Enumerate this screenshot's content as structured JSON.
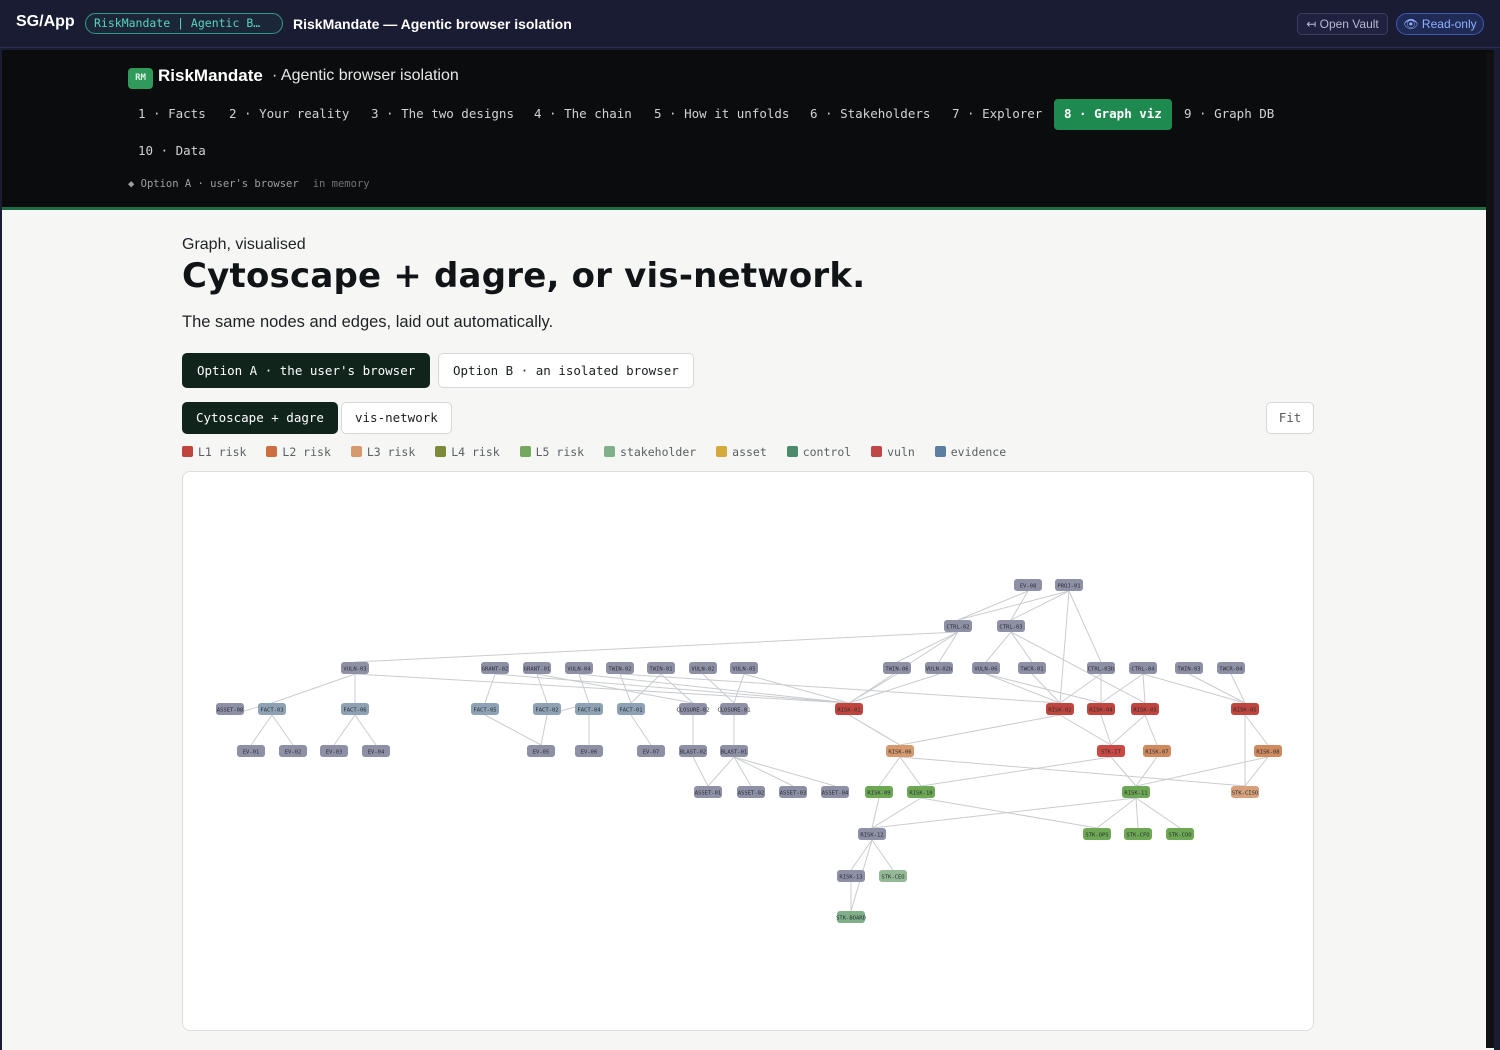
{
  "appbar": {
    "brand": "SG/App",
    "vault_pill": "RiskMandate | Agentic B…",
    "title": "RiskMandate — Agentic browser isolation",
    "open_vault": "↤ Open Vault",
    "read_only": "👁 Read-only"
  },
  "header": {
    "badge": "RM",
    "name": "RiskMandate",
    "subtitle": "· Agentic browser isolation",
    "tabs": [
      {
        "label": "1 · Facts",
        "active": false
      },
      {
        "label": "2 · Your reality",
        "active": false
      },
      {
        "label": "3 · The two designs",
        "active": false
      },
      {
        "label": "4 · The chain",
        "active": false
      },
      {
        "label": "5 · How it unfolds",
        "active": false
      },
      {
        "label": "6 · Stakeholders",
        "active": false
      },
      {
        "label": "7 · Explorer",
        "active": false
      },
      {
        "label": "8 · Graph viz",
        "active": true
      },
      {
        "label": "9 · Graph DB",
        "active": false
      },
      {
        "label": "10 · Data",
        "active": false
      }
    ],
    "status": "◆ Option A · user's browser",
    "status_mem": "in memory"
  },
  "main": {
    "eyebrow": "Graph, visualised",
    "title": "Cytoscape + dagre, or vis-network.",
    "lede": "The same nodes and edges, laid out automatically.",
    "options": [
      {
        "label": "Option A · the user's browser",
        "active": true
      },
      {
        "label": "Option B · an isolated browser",
        "active": false
      }
    ],
    "engines": [
      {
        "label": "Cytoscape + dagre",
        "active": true
      },
      {
        "label": "vis-network",
        "active": false
      }
    ],
    "fit_label": "Fit",
    "legend": [
      {
        "label": "L1 risk",
        "color": "#c0453e"
      },
      {
        "label": "L2 risk",
        "color": "#cd6e42"
      },
      {
        "label": "L3 risk",
        "color": "#d69a6c"
      },
      {
        "label": "L4 risk",
        "color": "#7c8a3a"
      },
      {
        "label": "L5 risk",
        "color": "#73a85e"
      },
      {
        "label": "stakeholder",
        "color": "#7fb08a"
      },
      {
        "label": "asset",
        "color": "#d5a93a"
      },
      {
        "label": "control",
        "color": "#4c8a6e"
      },
      {
        "label": "vuln",
        "color": "#bf4745"
      },
      {
        "label": "evidence",
        "color": "#5a7fa0"
      }
    ]
  },
  "graph": {
    "nodes": [
      {
        "id": "EV-08",
        "color": "#8e90a6"
      },
      {
        "id": "PROJ-01",
        "color": "#8e90a6"
      },
      {
        "id": "CTRL-02",
        "color": "#8e90a6"
      },
      {
        "id": "CTRL-03",
        "color": "#8e90a6"
      },
      {
        "id": "VULN-03",
        "color": "#8e90a6"
      },
      {
        "id": "GRANT-02",
        "color": "#8e90a6"
      },
      {
        "id": "GRANT-01",
        "color": "#8e90a6"
      },
      {
        "id": "VULN-04",
        "color": "#8e90a6"
      },
      {
        "id": "TWIN-02",
        "color": "#8e90a6"
      },
      {
        "id": "TWIN-01",
        "color": "#8e90a6"
      },
      {
        "id": "VULN-02",
        "color": "#8e90a6"
      },
      {
        "id": "VULN-05",
        "color": "#8e90a6"
      },
      {
        "id": "TWIN-06",
        "color": "#8e90a6"
      },
      {
        "id": "VULN-02b",
        "color": "#8e90a6"
      },
      {
        "id": "VULN-06",
        "color": "#8e90a6"
      },
      {
        "id": "TWCR-01",
        "color": "#8e90a6"
      },
      {
        "id": "CTRL-03b",
        "color": "#8e90a6"
      },
      {
        "id": "CTRL-04",
        "color": "#8e90a6"
      },
      {
        "id": "TWIN-03",
        "color": "#8e90a6"
      },
      {
        "id": "TWCR-04",
        "color": "#8e90a6"
      },
      {
        "id": "ASSET-08",
        "color": "#8e90a6"
      },
      {
        "id": "FACT-03",
        "color": "#8fa2b5"
      },
      {
        "id": "FACT-06",
        "color": "#8fa2b5"
      },
      {
        "id": "FACT-05",
        "color": "#8fa2b5"
      },
      {
        "id": "FACT-02",
        "color": "#8fa2b5"
      },
      {
        "id": "FACT-04",
        "color": "#8fa2b5"
      },
      {
        "id": "FACT-01",
        "color": "#8fa2b5"
      },
      {
        "id": "CLOSURE-02",
        "color": "#8e90a6"
      },
      {
        "id": "CLOSURE-01",
        "color": "#8e90a6"
      },
      {
        "id": "RISK-01",
        "color": "#c0453e"
      },
      {
        "id": "RISK-02",
        "color": "#c0453e"
      },
      {
        "id": "RISK-04",
        "color": "#c0453e"
      },
      {
        "id": "RISK-03",
        "color": "#c0453e"
      },
      {
        "id": "RISK-05",
        "color": "#c0453e"
      },
      {
        "id": "EV-01",
        "color": "#8e90a6"
      },
      {
        "id": "EV-02",
        "color": "#8e90a6"
      },
      {
        "id": "EV-03",
        "color": "#8e90a6"
      },
      {
        "id": "EV-04",
        "color": "#8e90a6"
      },
      {
        "id": "EV-05",
        "color": "#8e90a6"
      },
      {
        "id": "EV-06",
        "color": "#8e90a6"
      },
      {
        "id": "EV-07",
        "color": "#8e90a6"
      },
      {
        "id": "BLAST-02",
        "color": "#8e90a6"
      },
      {
        "id": "BLAST-01",
        "color": "#8e90a6"
      },
      {
        "id": "RISK-06",
        "color": "#d69a6c"
      },
      {
        "id": "STK-IT",
        "color": "#c94a45"
      },
      {
        "id": "RISK-07",
        "color": "#d08a5e"
      },
      {
        "id": "RISK-08",
        "color": "#d08a5e"
      },
      {
        "id": "ASSET-01",
        "color": "#8e90a6"
      },
      {
        "id": "ASSET-02",
        "color": "#8e90a6"
      },
      {
        "id": "ASSET-03",
        "color": "#8e90a6"
      },
      {
        "id": "ASSET-04",
        "color": "#8e90a6"
      },
      {
        "id": "RISK-09",
        "color": "#6da854"
      },
      {
        "id": "RISK-10",
        "color": "#6da854"
      },
      {
        "id": "RISK-11",
        "color": "#6da854"
      },
      {
        "id": "STK-CISO",
        "color": "#d6a07a"
      },
      {
        "id": "RISK-12",
        "color": "#8e90a6"
      },
      {
        "id": "STK-OPS",
        "color": "#6da854"
      },
      {
        "id": "STK-CFO",
        "color": "#6da854"
      },
      {
        "id": "STK-COO",
        "color": "#6da854"
      },
      {
        "id": "RISK-13",
        "color": "#8e90a6"
      },
      {
        "id": "STK-CEO",
        "color": "#93b995"
      },
      {
        "id": "STK-BOARD",
        "color": "#7fb08a"
      }
    ]
  }
}
